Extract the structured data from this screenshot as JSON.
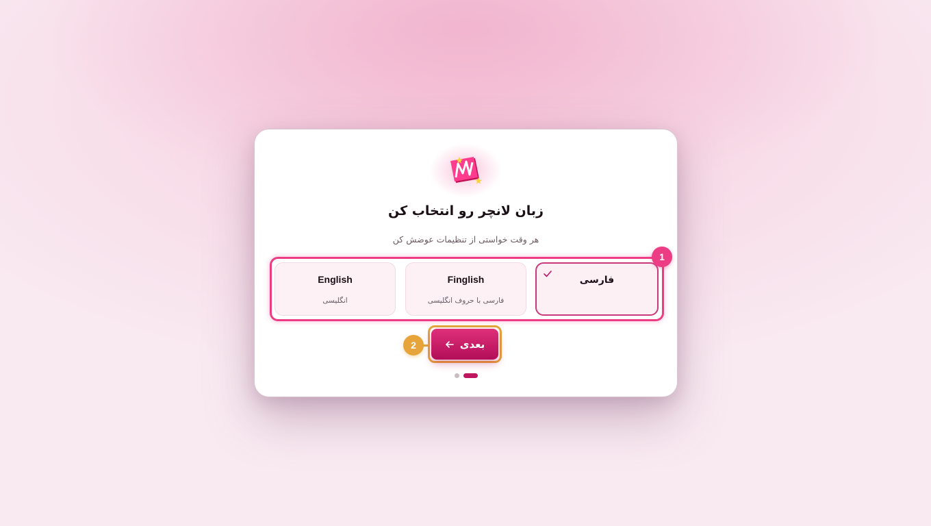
{
  "dialog": {
    "title": "زبان لانچر رو انتخاب کن",
    "subtitle": "هر وقت خواستی از تنظیمات عوضش کن"
  },
  "logo": {
    "icon": "launcher-logo-m-icon"
  },
  "language_options": [
    {
      "label": "فارسی",
      "sub": "",
      "selected": true
    },
    {
      "label": "Finglish",
      "sub": "فارسی با حروف انگلیسی",
      "selected": false
    },
    {
      "label": "English",
      "sub": "انگلیسی",
      "selected": false
    }
  ],
  "annotations": {
    "badge_1": "1",
    "badge_2": "2"
  },
  "next_button": {
    "label": "بعدی",
    "icon": "arrow-left-icon"
  },
  "pagination": {
    "total": 2,
    "current": 2
  },
  "colors": {
    "accent": "#ec3c84",
    "button": "#c0155f",
    "annotation_orange": "#e6a43a",
    "background": "#f9eaf1"
  }
}
